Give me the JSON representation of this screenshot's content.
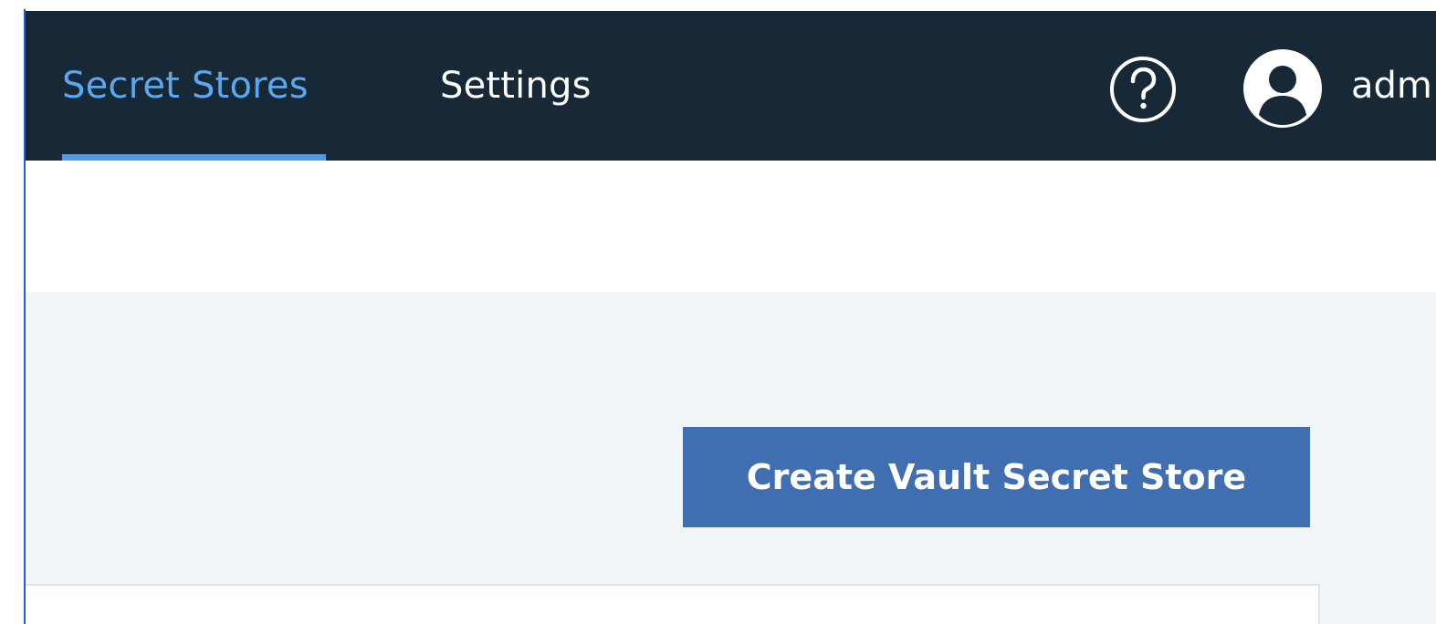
{
  "header": {
    "tabs": [
      {
        "label": "Secret Stores",
        "active": true
      },
      {
        "label": "Settings",
        "active": false
      }
    ],
    "help_icon": "question-circle-icon",
    "user_icon": "user-avatar-icon",
    "user_name": "adm"
  },
  "main": {
    "create_button_label": "Create Vault Secret Store"
  },
  "colors": {
    "header_bg": "#172836",
    "active_tab": "#5aa8f0",
    "primary_button": "#3f6fb1",
    "content_bg": "#f3f6f9"
  }
}
